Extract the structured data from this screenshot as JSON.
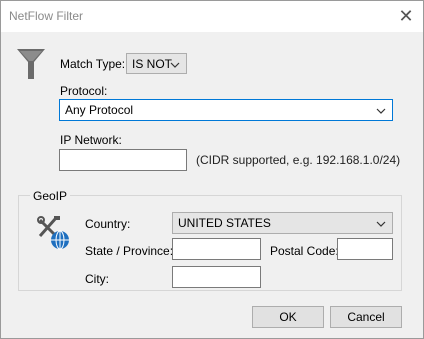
{
  "window": {
    "title": "NetFlow Filter"
  },
  "match_type": {
    "label": "Match Type:",
    "value": "IS NOT"
  },
  "protocol": {
    "label": "Protocol:",
    "value": "Any Protocol"
  },
  "ip_network": {
    "label": "IP Network:",
    "value": "",
    "hint": "(CIDR supported, e.g. 192.168.1.0/24)"
  },
  "geoip": {
    "legend": "GeoIP",
    "country_label": "Country:",
    "country_value": "UNITED STATES",
    "state_label": "State / Province:",
    "state_value": "",
    "postal_label": "Postal Code:",
    "postal_value": "",
    "city_label": "City:",
    "city_value": ""
  },
  "buttons": {
    "ok": "OK",
    "cancel": "Cancel"
  },
  "icons": {
    "filter": "filter-funnel-icon",
    "geoip": "tools-globe-icon",
    "chevron": "chevron-down-icon",
    "close": "close-icon"
  },
  "colors": {
    "focus_border": "#0078d7",
    "window_bg": "#f0f0f0",
    "title_text": "#8a8a8a"
  }
}
